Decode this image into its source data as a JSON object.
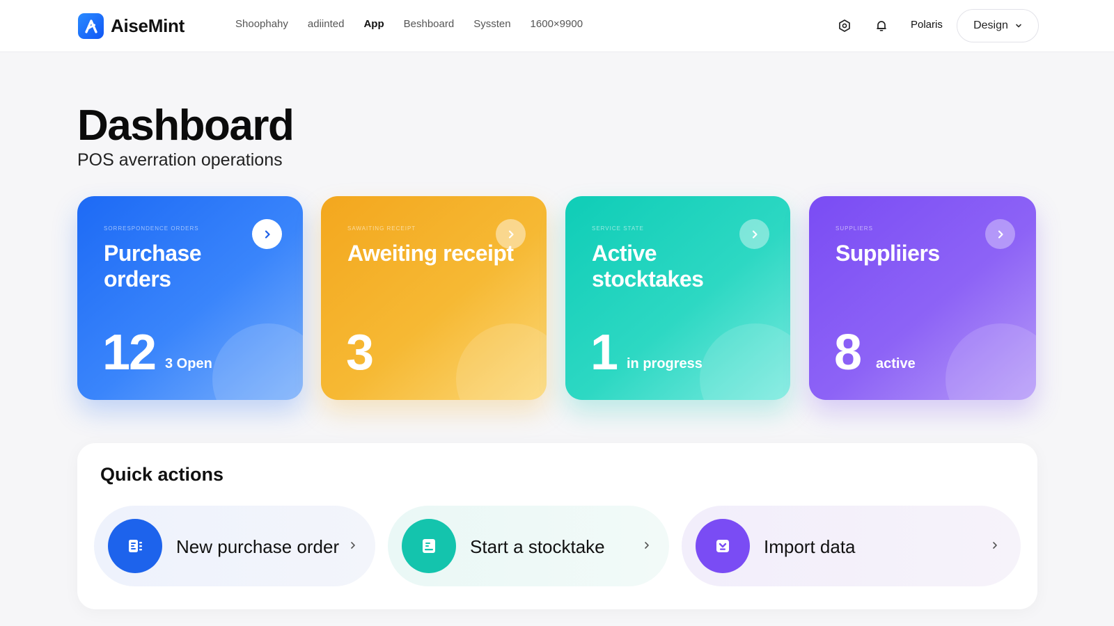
{
  "app": {
    "name": "AiseMint"
  },
  "nav": {
    "items": [
      {
        "label": "Shoophahy",
        "active": false
      },
      {
        "label": "adiinted",
        "active": false
      },
      {
        "label": "App",
        "active": true
      },
      {
        "label": "Beshboard",
        "active": false
      },
      {
        "label": "Syssten",
        "active": false
      },
      {
        "label": "1600×9900",
        "active": false
      }
    ]
  },
  "header": {
    "settings_icon": "hexagon-settings-icon",
    "notification_icon": "bell-icon",
    "user_name": "Polaris",
    "design_label": "Design"
  },
  "page": {
    "title": "Dashboard",
    "subtitle": "POS averration operations"
  },
  "stats": [
    {
      "kicker": "SORRESPONDENCE ORDERS",
      "title": "Purchase orders",
      "value": "12",
      "note": "3 Open",
      "color": "#1d6af5"
    },
    {
      "kicker": "SAWAITING RECEIPT",
      "title": "Aweiting receipt",
      "value": "3",
      "note": "",
      "color": "#f3a71e"
    },
    {
      "kicker": "SERVICE STATE",
      "title": "Active stocktakes",
      "value": "1",
      "note": "in progress",
      "color": "#0fcdb7"
    },
    {
      "kicker": "SUPPLIERS",
      "title": "Suppliiers",
      "value": "8",
      "note": "active",
      "color": "#7a4cf4"
    }
  ],
  "quick_actions": {
    "title": "Quick actions",
    "items": [
      {
        "label": "New purchase order",
        "icon": "purchase-order-icon",
        "color": "#1d63ec"
      },
      {
        "label": "Start a stocktake",
        "icon": "stocktake-icon",
        "color": "#14c4ad"
      },
      {
        "label": "Import data",
        "icon": "import-icon",
        "color": "#7a4cf4"
      }
    ]
  }
}
